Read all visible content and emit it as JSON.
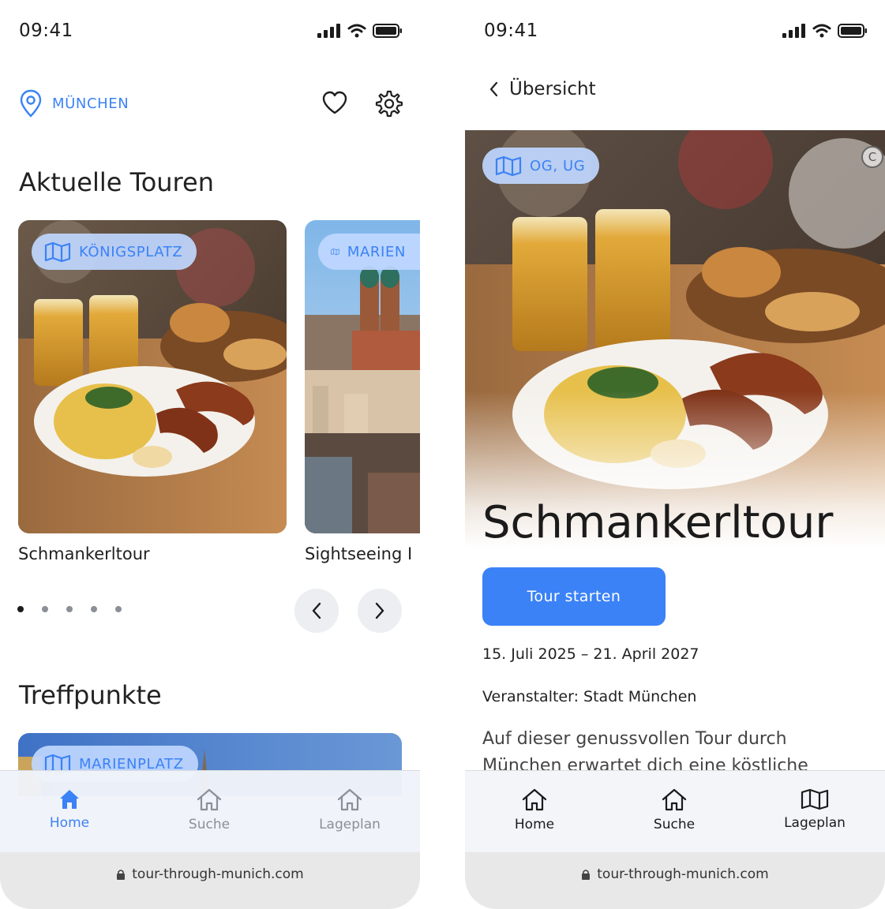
{
  "status_bar": {
    "time": "09:41"
  },
  "home": {
    "location": "MÜNCHEN",
    "section_tours": "Aktuelle Touren",
    "tours": [
      {
        "tag": "KÖNIGSPLATZ",
        "title": "Schmankerltour"
      },
      {
        "tag": "MARIEN",
        "title": "Sightseeing I"
      }
    ],
    "carousel": {
      "total_pages": 5,
      "active_page": 1
    },
    "section_meeting": "Treffpunkte",
    "meeting_points": [
      {
        "tag": "MARIENPLATZ"
      }
    ]
  },
  "detail": {
    "back_label": "Übersicht",
    "tag": "OG, UG",
    "copyright_symbol": "C",
    "title": "Schmankerltour",
    "start_button": "Tour starten",
    "dates": "15. Juli 2025 – 21. April 2027",
    "organizer": "Veranstalter: Stadt München",
    "description": "Auf dieser genussvollen Tour durch München erwartet dich eine köstliche"
  },
  "tabbar_left": {
    "active": "Home",
    "tabs": [
      {
        "label": "Home",
        "icon": "home-icon"
      },
      {
        "label": "Suche",
        "icon": "home-icon"
      },
      {
        "label": "Lageplan",
        "icon": "home-icon"
      }
    ]
  },
  "tabbar_right": {
    "tabs": [
      {
        "label": "Home",
        "icon": "home-icon"
      },
      {
        "label": "Suche",
        "icon": "home-icon"
      },
      {
        "label": "Lageplan",
        "icon": "map-icon"
      }
    ]
  },
  "browser": {
    "url": "tour-through-munich.com"
  },
  "colors": {
    "accent": "#3b82f6",
    "tag_bg": "#bfd7ff",
    "inactive": "#8b8f97"
  }
}
